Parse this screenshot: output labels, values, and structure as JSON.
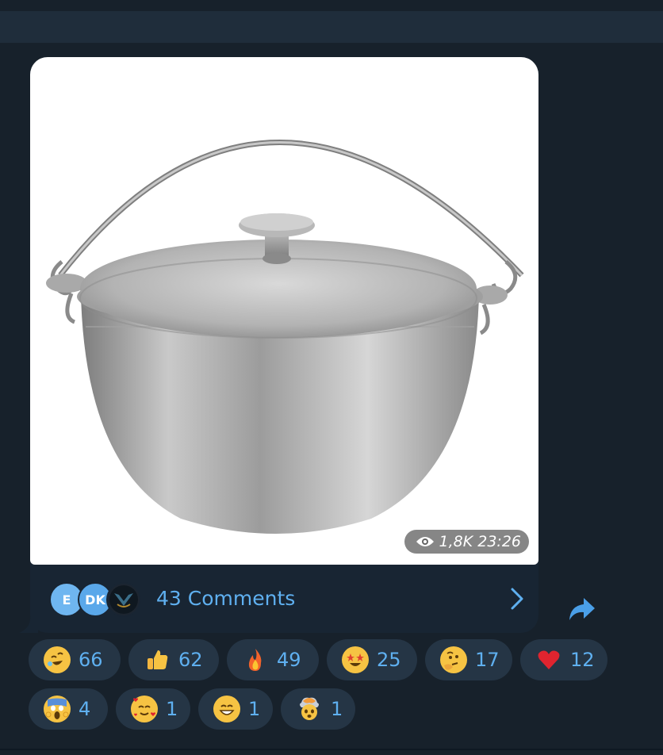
{
  "post": {
    "views": "1,8K",
    "time": "23:26",
    "comments_label": "43 Comments",
    "commenters": [
      {
        "initials": "E",
        "color": "#6fb6f0"
      },
      {
        "initials": "DK",
        "color": "#5aa8ea"
      },
      {
        "initials": "",
        "color": "#1c2530"
      }
    ]
  },
  "reactions": [
    {
      "emoji": "rolling-on-floor-laughing",
      "count": "66"
    },
    {
      "emoji": "thumbs-up",
      "count": "62"
    },
    {
      "emoji": "fire",
      "count": "49"
    },
    {
      "emoji": "star-struck",
      "count": "25"
    },
    {
      "emoji": "thinking-face",
      "count": "17"
    },
    {
      "emoji": "red-heart",
      "count": "12"
    },
    {
      "emoji": "face-screaming-in-fear",
      "count": "4"
    },
    {
      "emoji": "smiling-face-with-hearts",
      "count": "1"
    },
    {
      "emoji": "beaming-face",
      "count": "1"
    },
    {
      "emoji": "exploding-head",
      "count": "1"
    }
  ],
  "colors": {
    "background": "#17212b",
    "bubble": "#182533",
    "accent": "#5fb0f0",
    "reaction_bg": "#253545"
  }
}
